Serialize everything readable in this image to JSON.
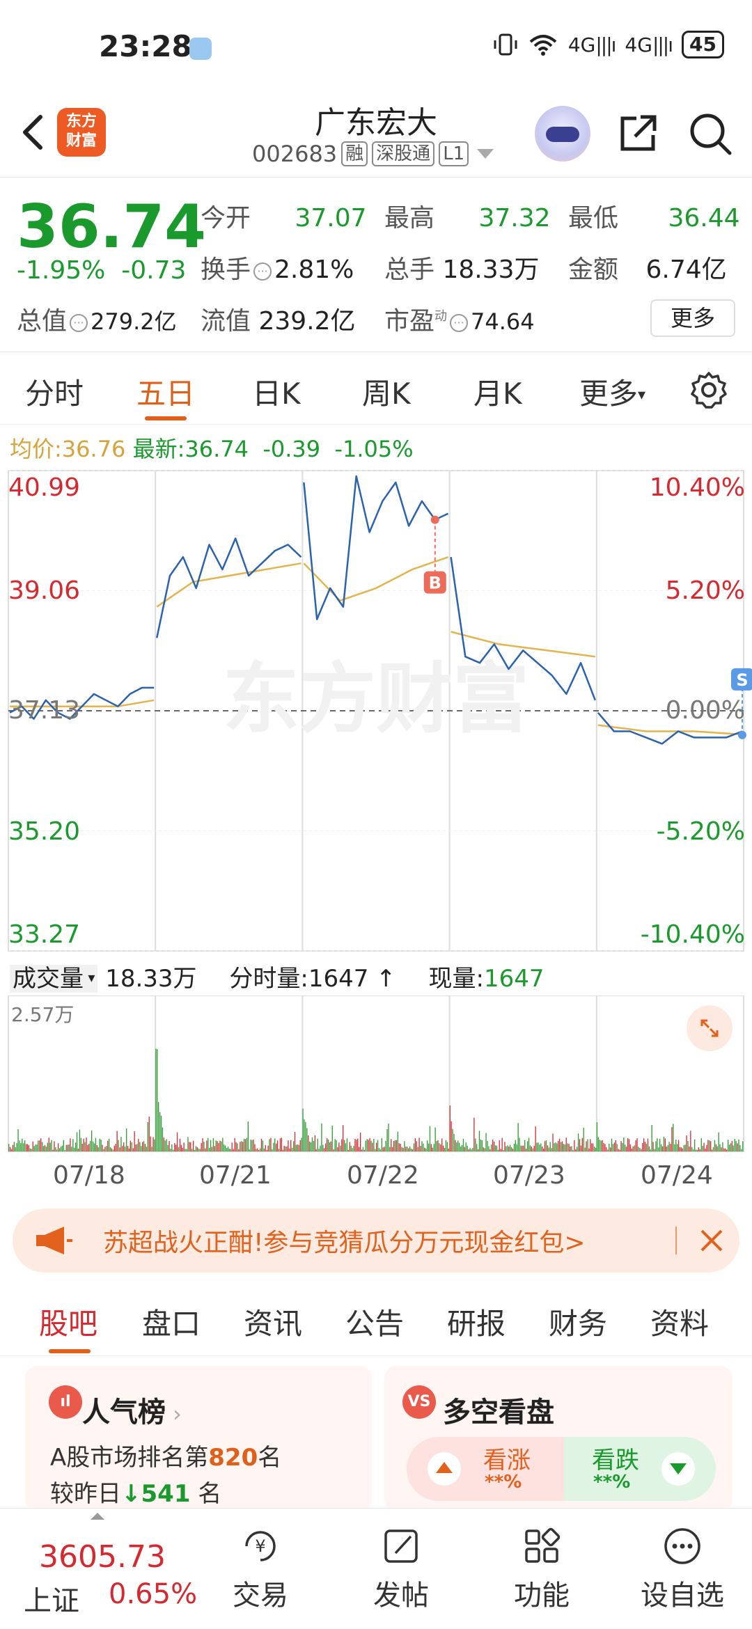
{
  "status_bar": {
    "time": "23:28",
    "signal1": "4G",
    "signal2": "4G",
    "battery": "45"
  },
  "header": {
    "logo_text": "东方\n财富",
    "stock_name": "广东宏大",
    "stock_code": "002683",
    "tags": [
      "融",
      "深股通",
      "L1"
    ]
  },
  "quote": {
    "price": "36.74",
    "change_pct": "-1.95%",
    "change_amt": "-0.73",
    "row1": [
      {
        "label": "今开",
        "value": "37.07"
      },
      {
        "label": "最高",
        "value": "37.32"
      },
      {
        "label": "最低",
        "value": "36.44"
      }
    ],
    "row2": [
      {
        "label": "换手",
        "value": "2.81%"
      },
      {
        "label": "总手",
        "value": "18.33万"
      },
      {
        "label": "金额",
        "value": "6.74亿"
      }
    ],
    "row3": [
      {
        "label": "总值",
        "value": "279.2亿"
      },
      {
        "label": "流值",
        "value": "239.2亿"
      },
      {
        "label": "市盈",
        "sup": "动",
        "value": "74.64"
      }
    ],
    "more_label": "更多"
  },
  "kline_tabs": {
    "items": [
      "分时",
      "五日",
      "日K",
      "周K",
      "月K",
      "更多"
    ],
    "active": "五日"
  },
  "avg_line": {
    "avg_label": "均价:",
    "avg_value": "36.76",
    "latest_label": "最新:",
    "latest_value": "36.74",
    "chg": "-0.39",
    "chg_pct": "-1.05%"
  },
  "chart_data": {
    "type": "line",
    "title": "",
    "y_left_labels": [
      "40.99",
      "39.06",
      "37.13",
      "35.20",
      "33.27"
    ],
    "y_right_labels": [
      "10.40%",
      "5.20%",
      "0.00%",
      "-5.20%",
      "-10.40%"
    ],
    "ylim": [
      33.27,
      40.99
    ],
    "base_price": 37.13,
    "days": [
      "07/18",
      "07/21",
      "07/22",
      "07/23",
      "07/24"
    ],
    "price_series": [
      [
        37.1,
        37.2,
        37.0,
        37.3,
        37.1,
        37.0,
        37.2,
        37.4,
        37.3,
        37.2,
        37.4,
        37.5,
        37.5
      ],
      [
        38.3,
        39.3,
        39.6,
        39.1,
        39.8,
        39.4,
        39.9,
        39.3,
        39.5,
        39.7,
        39.8,
        39.6
      ],
      [
        40.8,
        38.6,
        39.1,
        38.8,
        40.9,
        40.0,
        40.5,
        40.8,
        40.1,
        40.5,
        40.2,
        40.3
      ],
      [
        39.6,
        38.0,
        37.9,
        38.2,
        37.8,
        38.1,
        37.9,
        37.7,
        37.4,
        37.9,
        37.3
      ],
      [
        37.1,
        36.8,
        36.8,
        36.7,
        36.6,
        36.8,
        36.7,
        36.7,
        36.7,
        36.8
      ]
    ],
    "avg_series": [
      [
        37.2,
        37.2,
        37.2,
        37.2,
        37.3
      ],
      [
        38.8,
        39.2,
        39.3,
        39.4,
        39.5
      ],
      [
        39.5,
        38.9,
        39.1,
        39.4,
        39.6
      ],
      [
        38.4,
        38.2,
        38.1,
        38.0
      ],
      [
        36.9,
        36.8,
        36.8,
        36.75
      ]
    ],
    "markers": [
      {
        "label": "B",
        "day": 2,
        "price": 40.2
      },
      {
        "label": "S",
        "day": 4,
        "price": 36.74
      }
    ],
    "watermark": "东方财富"
  },
  "volume": {
    "selector_label": "成交量",
    "total": "18.33万",
    "tick_label": "分时量:1647",
    "current_label": "现量:",
    "current_value": "1647",
    "max_label": "2.57万"
  },
  "banner": {
    "text": "苏超战火正酣!参与竞猜瓜分万元现金红包>"
  },
  "bottom_tabs": {
    "items": [
      "股吧",
      "盘口",
      "资讯",
      "公告",
      "研报",
      "财务",
      "资料"
    ],
    "active": "股吧"
  },
  "popularity_card": {
    "icon": "ıl",
    "title": "人气榜",
    "rank_prefix": "A股市场排名第",
    "rank": "820",
    "rank_suffix": "名",
    "change_prefix": "较昨日",
    "change_value": "541",
    "change_suffix": "名"
  },
  "bullbear_card": {
    "icon": "VS",
    "title": "多空看盘",
    "up_label": "看涨",
    "up_pct": "**%",
    "down_label": "看跌",
    "down_pct": "**%"
  },
  "bottom_nav": {
    "index_value": "3605.73",
    "index_name": "上证",
    "index_change": "0.65%",
    "items": [
      "交易",
      "发帖",
      "功能",
      "设自选"
    ]
  },
  "colors": {
    "up": "#d6282f",
    "down": "#1a9a2c",
    "accent": "#e0601a",
    "price_line": "#2a62b0",
    "avg_line": "#e4b44c"
  }
}
